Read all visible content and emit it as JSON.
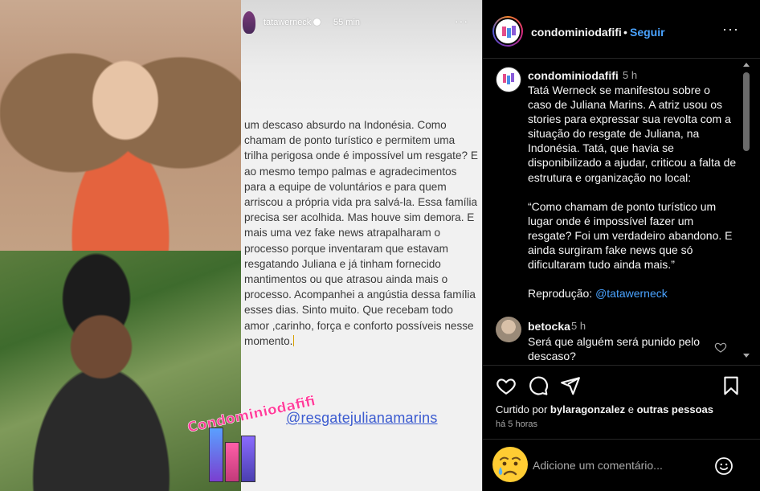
{
  "story": {
    "username": "tatawerneck",
    "time": "55 min",
    "more": "···",
    "text": "um descaso absurdo na Indonésia. Como\nchamam de ponto turístico e permitem uma\ntrilha perigosa onde é impossível um resgate? E\nao mesmo tempo palmas e agradecimentos\npara a equipe de voluntários e para quem\narriscou a própria vida pra salvá-la. Essa família\nprecisa ser acolhida. Mas houve sim demora. E\nmais uma vez fake news atrapalharam o\nprocesso porque inventaram que estavam\nresgatando Juliana e já tinham fornecido\nmantimentos ou que atrasou ainda mais o\nprocesso. Acompanhei a angústia dessa família\nesses dias. Sinto muito. Que recebam todo\namor ,carinho, força e conforto possíveis nesse\nmomento.",
    "mention": "@resgatejulianamarins",
    "watermark": "Condominiodafifi"
  },
  "header": {
    "username": "condominiodafifi",
    "separator": "•",
    "follow_label": "Seguir",
    "more": "···"
  },
  "caption": {
    "username": "condominiodafifi",
    "time": "5 h",
    "text": "Tatá Werneck se manifestou sobre o caso de Juliana Marins. A atriz usou os stories para expressar sua revolta com a situação do resgate de Juliana, na Indonésia. Tatá, que havia se disponibilizado a ajudar, criticou a falta de estrutura e organização no local:\n\n“Como chamam de ponto turístico um lugar onde é impossível fazer um resgate? Foi um verdadeiro abandono. E ainda surgiram fake news que só dificultaram tudo ainda mais.”\n\nReprodução: ",
    "credit_link": "@tatawerneck"
  },
  "comment": {
    "username": "betocka",
    "time": "5 h",
    "text": "Será que alguém será punido pelo descaso?"
  },
  "actions": {
    "liked_prefix": "Curtido por ",
    "liked_user": "bylaragonzalez",
    "liked_joiner": " e ",
    "liked_others": "outras pessoas",
    "time": "há 5 horas"
  },
  "comment_box": {
    "placeholder": "Adicione um comentário..."
  },
  "colors": {
    "accent": "#4aa3ff",
    "background": "#000000",
    "text": "#f5f5f5",
    "muted": "#a8a8a8",
    "watermark": "#ff3d9a",
    "link_in_story": "#3b5bd0"
  },
  "icons": [
    "verified-icon",
    "more-icon",
    "heart-icon",
    "comment-icon",
    "share-icon",
    "bookmark-icon",
    "crying-emoji-icon",
    "smiley-icon"
  ]
}
